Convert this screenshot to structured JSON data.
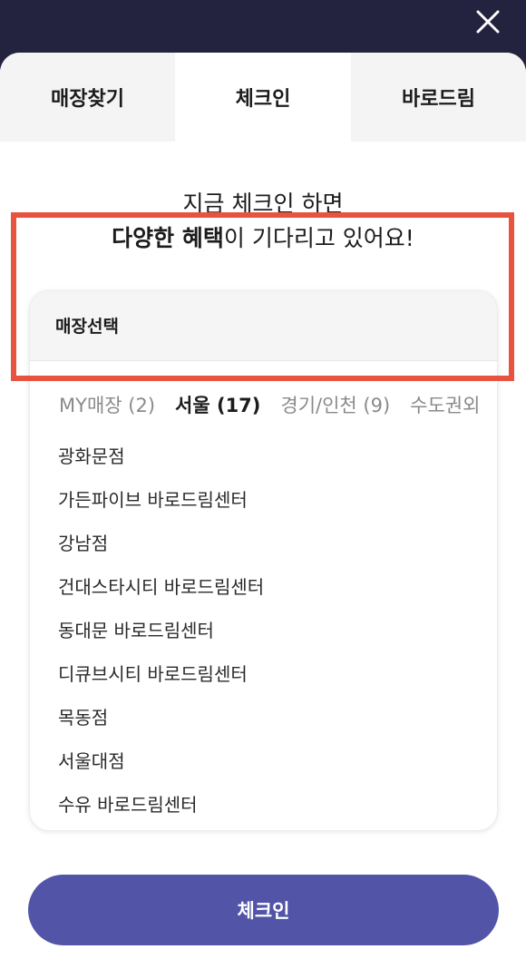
{
  "tabs": [
    {
      "label": "매장찾기"
    },
    {
      "label": "체크인"
    },
    {
      "label": "바로드림"
    }
  ],
  "headline": {
    "line1": "지금 체크인 하면",
    "line2_bold": "다양한 혜택",
    "line2_rest": "이 기다리고 있어요!"
  },
  "store_card": {
    "title": "매장선택",
    "region_tabs": [
      {
        "label": "MY매장 (2)"
      },
      {
        "label": "서울 (17)"
      },
      {
        "label": "경기/인천 (9)"
      },
      {
        "label": "수도권외"
      }
    ],
    "stores": [
      "광화문점",
      "가든파이브 바로드림센터",
      "강남점",
      "건대스타시티 바로드림센터",
      "동대문 바로드림센터",
      "디큐브시티 바로드림센터",
      "목동점",
      "서울대점",
      "수유 바로드림센터"
    ]
  },
  "checkin_button": {
    "label": "체크인"
  },
  "colors": {
    "header_bg": "#232340",
    "accent": "#5254a8",
    "highlight": "#e8533f"
  },
  "icons": {
    "close": "close-icon"
  }
}
